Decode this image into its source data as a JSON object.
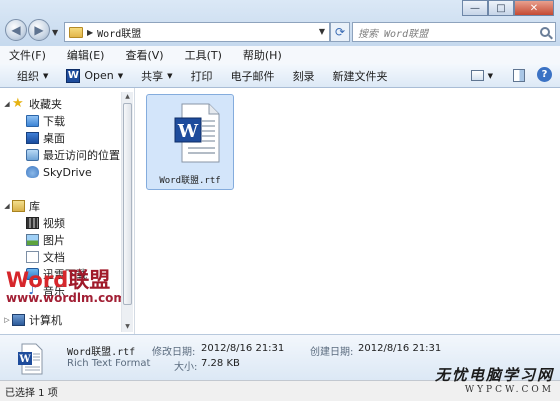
{
  "address": {
    "crumb": "Word联盟"
  },
  "search": {
    "placeholder": "搜索 Word联盟"
  },
  "window_buttons": {
    "minimize": "—",
    "maximize": "□",
    "close": "✕"
  },
  "menu": [
    "文件(F)",
    "编辑(E)",
    "查看(V)",
    "工具(T)",
    "帮助(H)"
  ],
  "commands": {
    "organize": "组织",
    "open": "Open",
    "share": "共享",
    "print": "打印",
    "email": "电子邮件",
    "burn": "刻录",
    "new_folder": "新建文件夹"
  },
  "nav": {
    "favorites": "收藏夹",
    "downloads": "下载",
    "desktop": "桌面",
    "recent": "最近访问的位置",
    "skydrive": "SkyDrive",
    "libraries": "库",
    "videos": "视频",
    "pictures": "图片",
    "documents": "文档",
    "thunder": "迅雷下载",
    "music": "音乐",
    "computer": "计算机"
  },
  "watermark": {
    "word": "Word",
    "brand": "联盟",
    "url": "www.wordlm.com"
  },
  "file": {
    "name": "Word联盟.rtf"
  },
  "details": {
    "name": "Word联盟.rtf",
    "type": "Rich Text Format",
    "modified_label": "修改日期:",
    "modified": "2012/8/16 21:31",
    "created_label": "创建日期:",
    "created": "2012/8/16 21:31",
    "size_label": "大小:",
    "size": "7.28 KB"
  },
  "status": {
    "text": "已选择 1 项"
  },
  "brand_watermark": {
    "cn": "无忧电脑学习网",
    "url": "WYPCW.COM"
  },
  "colors": {
    "selection": "#d3e5fa",
    "word_blue": "#1e4c9c",
    "watermark_red": "#d6262b"
  }
}
